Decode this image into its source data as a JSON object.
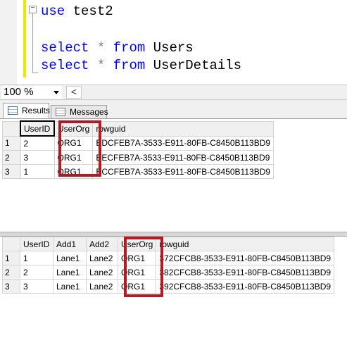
{
  "editor": {
    "fold_glyph": "−",
    "lines": [
      {
        "kw": "use",
        "rest": " test2"
      },
      {
        "kw": "",
        "rest": ""
      },
      {
        "kw": "select",
        "op": " * ",
        "kw2": "from",
        "rest": " Users"
      },
      {
        "kw": "select",
        "op": " * ",
        "kw2": "from",
        "rest": " UserDetails"
      }
    ]
  },
  "toolbar": {
    "zoom": "100 %",
    "scroll_left": "<"
  },
  "tabs": {
    "results": "Results",
    "messages": "Messages"
  },
  "grid1": {
    "columns": [
      "UserID",
      "UserOrg",
      "rowguid"
    ],
    "rows": [
      {
        "num": "1",
        "cells": [
          "2",
          "ORG1",
          "BDCFEB7A-3533-E911-80FB-C8450B113BD9"
        ]
      },
      {
        "num": "2",
        "cells": [
          "3",
          "ORG1",
          "BECFEB7A-3533-E911-80FB-C8450B113BD9"
        ]
      },
      {
        "num": "3",
        "cells": [
          "1",
          "ORG1",
          "BCCFEB7A-3533-E911-80FB-C8450B113BD9"
        ]
      }
    ]
  },
  "grid2": {
    "columns": [
      "UserID",
      "Add1",
      "Add2",
      "UserOrg",
      "rowguid"
    ],
    "rows": [
      {
        "num": "1",
        "cells": [
          "1",
          "Lane1",
          "Lane2",
          "ORG1",
          "372CFCB8-3533-E911-80FB-C8450B113BD9"
        ]
      },
      {
        "num": "2",
        "cells": [
          "2",
          "Lane1",
          "Lane2",
          "ORG1",
          "382CFCB8-3533-E911-80FB-C8450B113BD9"
        ]
      },
      {
        "num": "3",
        "cells": [
          "3",
          "Lane1",
          "Lane2",
          "ORG1",
          "392CFCB8-3533-E911-80FB-C8450B113BD9"
        ]
      }
    ]
  },
  "colors": {
    "keyword": "#0000ff",
    "highlight": "#b01c24"
  }
}
